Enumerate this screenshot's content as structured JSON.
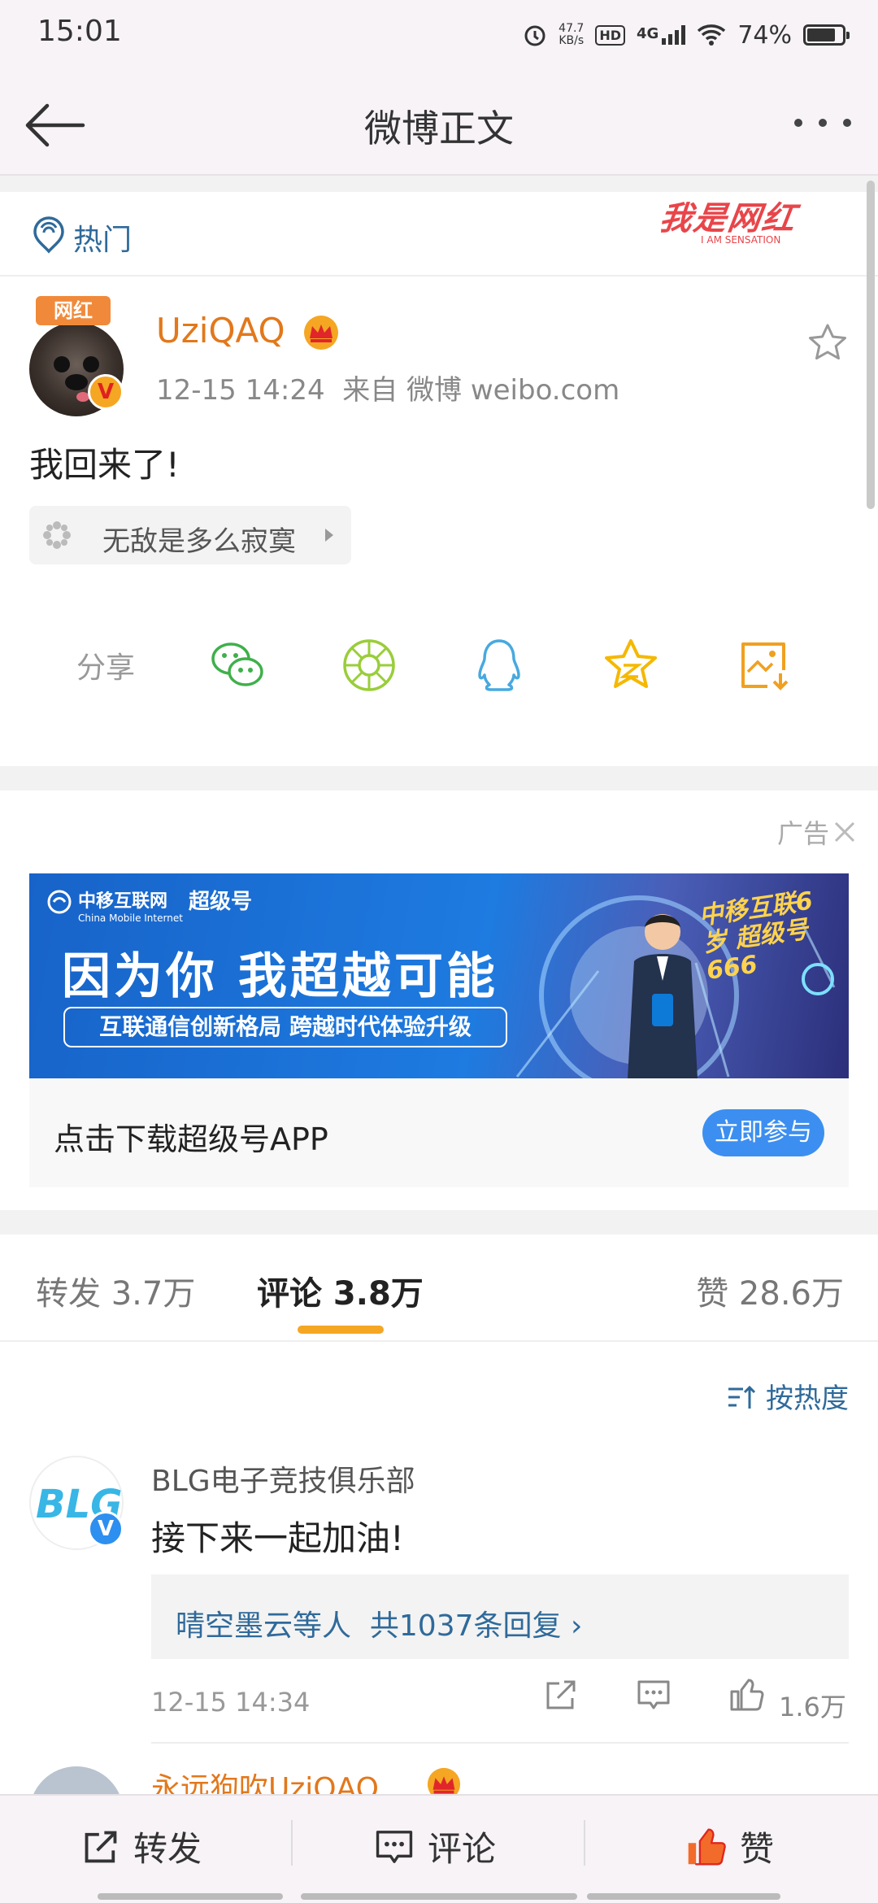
{
  "status_bar": {
    "time": "15:01",
    "net_speed": "47.7",
    "net_unit": "KB/s",
    "hd": "HD",
    "signal": "4G",
    "battery": "74%"
  },
  "nav": {
    "title": "微博正文"
  },
  "hot": {
    "label": "热门",
    "watermark": "我是网红",
    "watermark_sub": "I AM SENSATION"
  },
  "post": {
    "avatar_tag": "网红",
    "badge": "V",
    "username": "UziQAQ",
    "time": "12-15 14:24",
    "source": "来自 微博 weibo.com",
    "content": "我回来了!",
    "topic": "无敌是多么寂寞",
    "share_label": "分享"
  },
  "ad": {
    "label": "广告",
    "brand": "中移互联网",
    "brand_sub": "China Mobile Internet",
    "brand2": "超级号",
    "headline": "因为你 我超越可能",
    "subline": "互联通信创新格局 跨越时代体验升级",
    "corner": "中移互联6岁 超级号666",
    "cta_text": "点击下载超级号APP",
    "cta_button": "立即参与"
  },
  "tabs": {
    "repost": "转发 3.7万",
    "comment": "评论 3.8万",
    "like": "赞 28.6万"
  },
  "sort": {
    "label": "按热度"
  },
  "comments": [
    {
      "logo": "BLG",
      "badge": "V",
      "name": "BLG电子竞技俱乐部",
      "text": "接下来一起加油!",
      "replies_by": "晴空墨云等人",
      "replies_count": "共1037条回复 ›",
      "time": "12-15 14:34",
      "likes": "1.6万"
    },
    {
      "name": "永远狗吹UziQAQ"
    }
  ],
  "bottom_bar": {
    "repost": "转发",
    "comment": "评论",
    "like": "赞"
  },
  "colors": {
    "accent_orange": "#f5a623",
    "link_blue": "#2f6a9a",
    "username_orange": "#e2781b",
    "cta_blue": "#3c8ff0"
  }
}
